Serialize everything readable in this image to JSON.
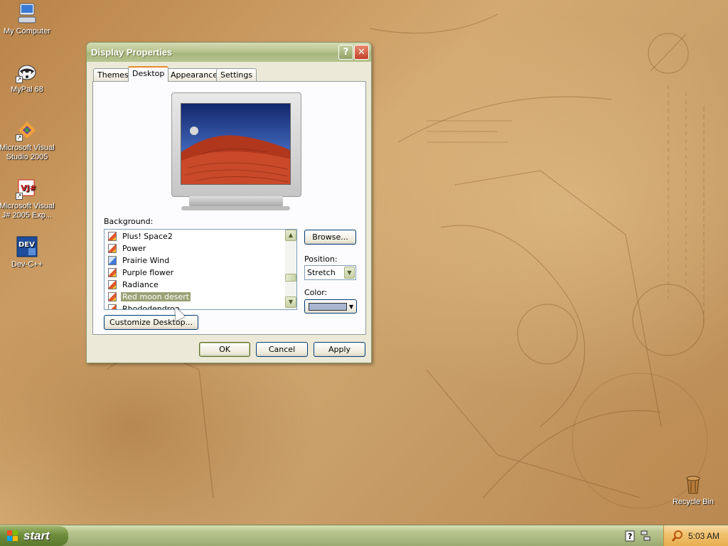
{
  "desktop": {
    "icons": [
      {
        "label": "My Computer",
        "icon": "my-computer-icon"
      },
      {
        "label": "MyPal 68",
        "icon": "mypal-raccoon-icon"
      },
      {
        "label": "Microsoft Visual Studio 2005",
        "icon": "visual-studio-icon"
      },
      {
        "label": "Microsoft Visual J# 2005 Exp...",
        "icon": "visual-jsharp-icon"
      },
      {
        "label": "Dev-C++",
        "icon": "dev-cpp-icon"
      },
      {
        "label": "Recycle Bin",
        "icon": "recycle-bin-icon"
      }
    ]
  },
  "dialog": {
    "title": "Display Properties",
    "help_glyph": "?",
    "close_glyph": "✕",
    "tabs": [
      {
        "label": "Themes",
        "active": false
      },
      {
        "label": "Desktop",
        "active": true
      },
      {
        "label": "Appearance",
        "active": false
      },
      {
        "label": "Settings",
        "active": false
      }
    ],
    "background_label": "Background:",
    "backgrounds": [
      {
        "label": "Plus! Space2",
        "selected": false
      },
      {
        "label": "Power",
        "selected": false
      },
      {
        "label": "Prairie Wind",
        "selected": false
      },
      {
        "label": "Purple flower",
        "selected": false
      },
      {
        "label": "Radiance",
        "selected": false
      },
      {
        "label": "Red moon desert",
        "selected": true
      },
      {
        "label": "Rhododendron",
        "selected": false
      }
    ],
    "browse_label": "Browse...",
    "position_label": "Position:",
    "position_value": "Stretch",
    "color_label": "Color:",
    "color_value": "#a9b6d2",
    "customize_label": "Customize Desktop...",
    "ok_label": "OK",
    "cancel_label": "Cancel",
    "apply_label": "Apply"
  },
  "taskbar": {
    "start_label": "start",
    "clock": "5:03 AM"
  },
  "colors": {
    "title_start": "#d3dbb4",
    "title_end": "#a8b67d",
    "selection": "#9aa276",
    "tab_accent": "#e68b2c",
    "taskbar": "#b8c58f",
    "tray": "#f0c26f"
  }
}
